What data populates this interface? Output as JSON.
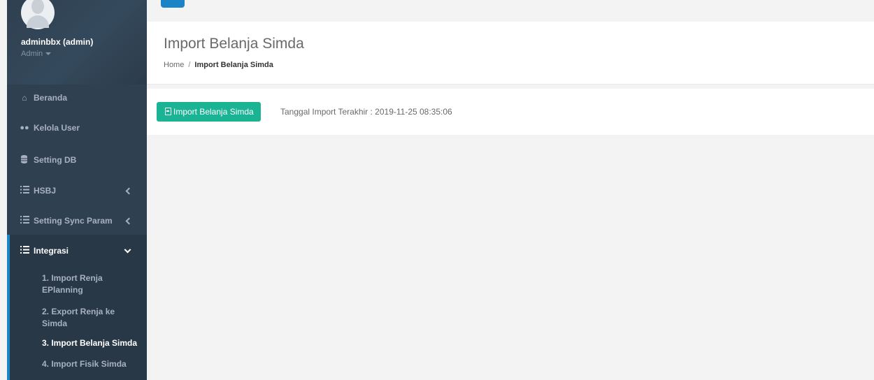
{
  "user": {
    "name": "adminbbx (admin)",
    "role": "Admin"
  },
  "nav": {
    "beranda": "Beranda",
    "kelola_user": "Kelola User",
    "setting_db": "Setting DB",
    "hsbj": "HSBJ",
    "setting_sync": "Setting Sync Param",
    "integrasi": "Integrasi",
    "sub": [
      {
        "line1": "1. Import Renja",
        "line2": "EPlanning"
      },
      {
        "line1": "2. Export Renja ke",
        "line2": "Simda"
      },
      {
        "line1": "3. Import Belanja Simda",
        "line2": ""
      },
      {
        "line1": "4. Import Fisik Simda",
        "line2": ""
      }
    ]
  },
  "page": {
    "title": "Import Belanja Simda",
    "breadcrumb_home": "Home",
    "breadcrumb_sep": "/",
    "breadcrumb_current": "Import Belanja Simda"
  },
  "content": {
    "button_label": "Import Belanja Simda",
    "last_import": "Tanggal Import Terakhir : 2019-11-25 08:35:06"
  },
  "colors": {
    "sidebar": "#2f4050",
    "accent": "#1c84c6",
    "button": "#1ab394"
  }
}
